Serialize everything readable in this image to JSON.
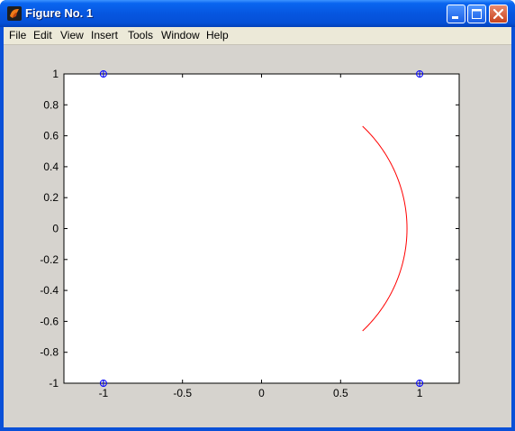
{
  "window": {
    "title": "Figure No. 1",
    "app_icon": "matlab-icon"
  },
  "titlebar_buttons": [
    "minimize-icon",
    "maximize-icon",
    "close-icon"
  ],
  "menu": [
    "File",
    "Edit",
    "View",
    "Insert",
    "Tools",
    "Window",
    "Help"
  ],
  "colors": {
    "figure_bg": "#d6d3ce",
    "axes_bg": "#ffffff",
    "arc": "#ff0000",
    "markers": "#0000ff",
    "titlebar": "#0556dd"
  },
  "chart_data": {
    "type": "scatter",
    "title": "",
    "xlabel": "",
    "ylabel": "",
    "xlim": [
      -1.25,
      1.25
    ],
    "ylim": [
      -1,
      1
    ],
    "xticks": [
      -1,
      -0.5,
      0,
      0.5,
      1
    ],
    "xtick_labels": [
      "-1",
      "-0.5",
      "0",
      "0.5",
      "1"
    ],
    "yticks": [
      1,
      0.8,
      0.6,
      0.4,
      0.2,
      0,
      -0.2,
      -0.4,
      -0.6,
      -0.8,
      -1
    ],
    "ytick_labels": [
      "1",
      "0.8",
      "0.6",
      "0.4",
      "0.2",
      "0",
      "-0.2",
      "-0.4",
      "-0.6",
      "-0.8",
      "-1"
    ],
    "grid": false,
    "series": [
      {
        "style": "markers",
        "marker": "circle",
        "color": "#0000ff",
        "x": [
          -1,
          1,
          -1,
          1
        ],
        "y": [
          1,
          1,
          -1,
          -1
        ]
      },
      {
        "style": "line",
        "shape": "arc",
        "color": "#ff0000",
        "center": [
          0,
          0
        ],
        "radius": 0.92,
        "angle_range_deg": [
          -46,
          46
        ]
      }
    ]
  }
}
